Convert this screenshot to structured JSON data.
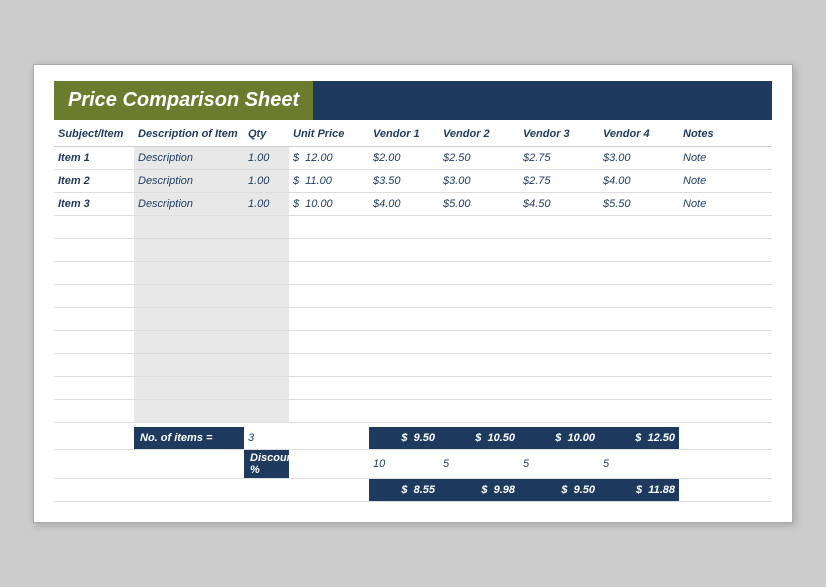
{
  "title": "Price Comparison Sheet",
  "headers": {
    "subject": "Subject/Item",
    "description": "Description of Item",
    "qty": "Qty",
    "unit_price": "Unit Price",
    "vendor1": "Vendor 1",
    "vendor2": "Vendor 2",
    "vendor3": "Vendor 3",
    "vendor4": "Vendor 4",
    "notes": "Notes"
  },
  "rows": [
    {
      "item": "Item 1",
      "description": "Description",
      "qty": "1.00",
      "unit_price_symbol": "$",
      "unit_price_val": "12.00",
      "vendor1": "$2.00",
      "vendor2": "$2.50",
      "vendor3": "$2.75",
      "vendor4": "$3.00",
      "notes": "Note"
    },
    {
      "item": "Item 2",
      "description": "Description",
      "qty": "1.00",
      "unit_price_symbol": "$",
      "unit_price_val": "11.00",
      "vendor1": "$3.50",
      "vendor2": "$3.00",
      "vendor3": "$2.75",
      "vendor4": "$4.00",
      "notes": "Note"
    },
    {
      "item": "Item 3",
      "description": "Description",
      "qty": "1.00",
      "unit_price_symbol": "$",
      "unit_price_val": "10.00",
      "vendor1": "$4.00",
      "vendor2": "$5.00",
      "vendor3": "$4.50",
      "vendor4": "$5.50",
      "notes": "Note"
    }
  ],
  "empty_row_count": 9,
  "footer": {
    "no_of_items_label": "No. of items =",
    "no_of_items_val": "3",
    "v1_total": "9.50",
    "v2_total": "10.50",
    "v3_total": "10.00",
    "v4_total": "12.50",
    "discount_label": "Discount %",
    "v1_discount": "10",
    "v2_discount": "5",
    "v3_discount": "5",
    "v4_discount": "5",
    "v1_final": "8.55",
    "v2_final": "9.98",
    "v3_final": "9.50",
    "v4_final": "11.88"
  }
}
